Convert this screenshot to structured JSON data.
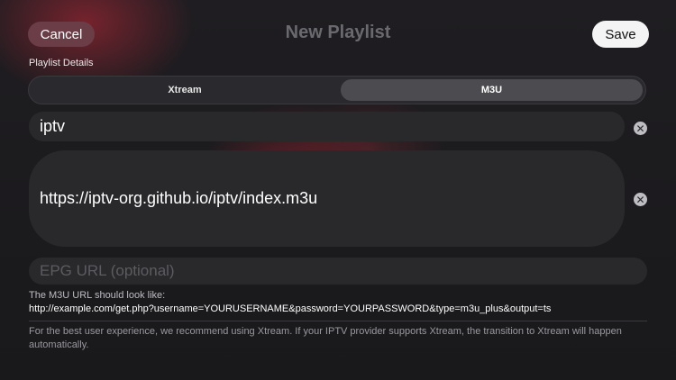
{
  "header": {
    "cancel_label": "Cancel",
    "title": "New Playlist",
    "save_label": "Save"
  },
  "section_label": "Playlist Details",
  "segment": {
    "options": [
      "Xtream",
      "M3U"
    ],
    "selected": "M3U"
  },
  "fields": {
    "name_value": "iptv",
    "url_value": "https://iptv-org.github.io/iptv/index.m3u",
    "epg_placeholder": "EPG URL (optional)"
  },
  "hint": {
    "label": "The M3U URL should look like:",
    "example": "http://example.com/get.php?username=YOURUSERNAME&password=YOURPASSWORD&type=m3u_plus&output=ts"
  },
  "note": "For the best user experience, we recommend using Xtream. If your IPTV provider supports Xtream, the transition to Xtream will happen automatically.",
  "icons": {
    "clear": "x-circle-icon"
  },
  "colors": {
    "cancel_bg": "#6b3d47",
    "save_bg": "#f4f4f4",
    "selected_segment_bg": "#4c4c50"
  }
}
